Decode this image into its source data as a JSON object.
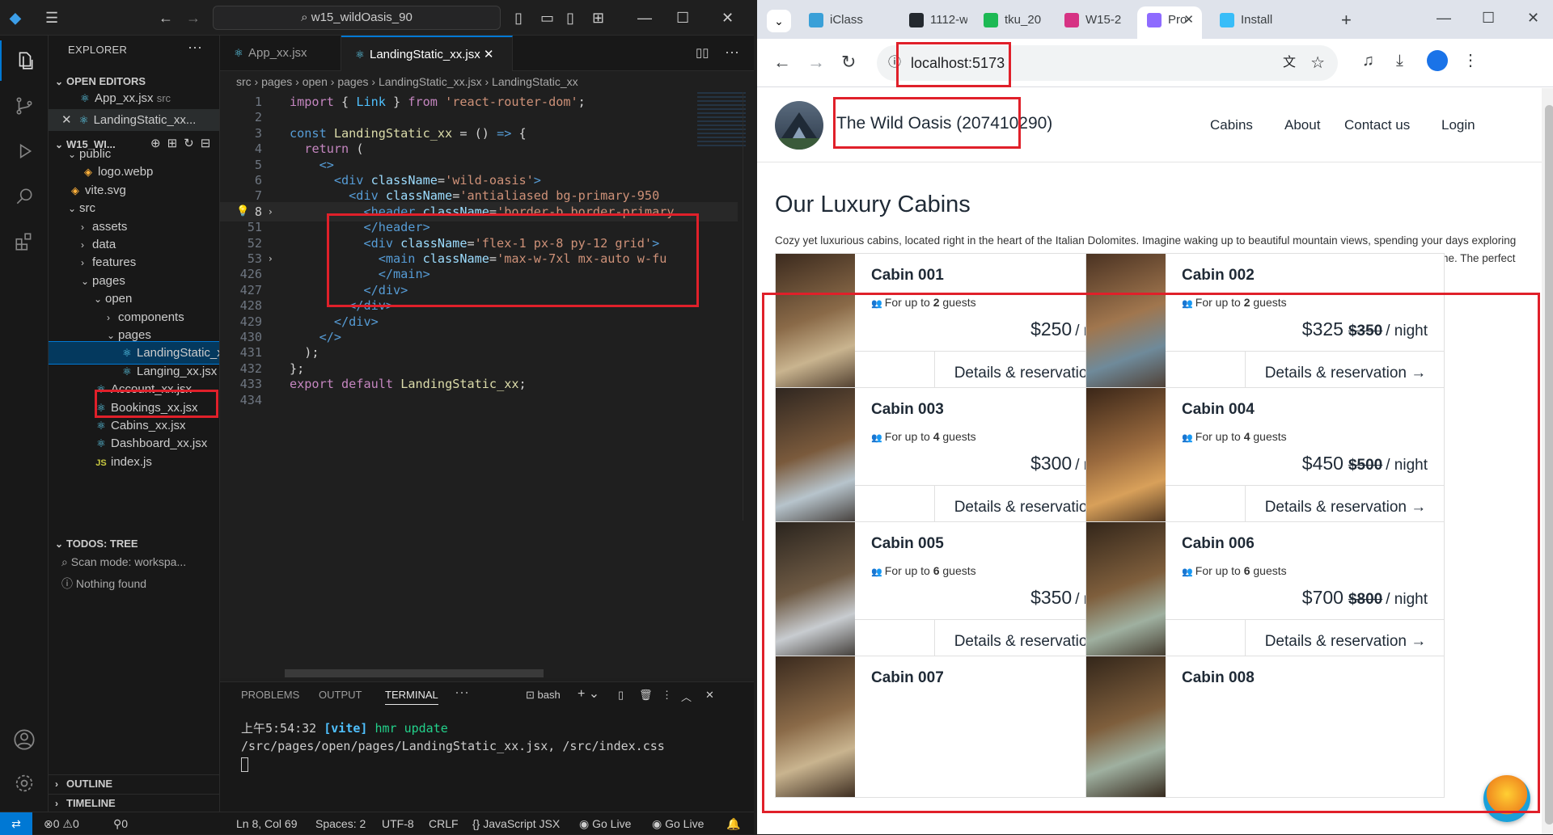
{
  "vscode": {
    "command_center": "w15_wildOasis_90",
    "explorer_title": "EXPLORER",
    "open_editors_title": "OPEN EDITORS",
    "open_editors": [
      {
        "name": "App_xx.jsx",
        "detail": "src"
      },
      {
        "name": "LandingStatic_xx..."
      }
    ],
    "workspace_title": "W15_WI...",
    "tree": [
      {
        "label": "public",
        "type": "folder"
      },
      {
        "label": "logo.webp",
        "type": "file"
      },
      {
        "label": "vite.svg",
        "type": "file"
      },
      {
        "label": "src",
        "type": "folder"
      },
      {
        "label": "assets",
        "type": "folder"
      },
      {
        "label": "data",
        "type": "folder"
      },
      {
        "label": "features",
        "type": "folder"
      },
      {
        "label": "pages",
        "type": "folder"
      },
      {
        "label": "open",
        "type": "folder"
      },
      {
        "label": "components",
        "type": "folder"
      },
      {
        "label": "pages",
        "type": "folder"
      },
      {
        "label": "LandingStatic_x...",
        "type": "file"
      },
      {
        "label": "Langing_xx.jsx",
        "type": "file"
      },
      {
        "label": "Account_xx.jsx",
        "type": "file"
      },
      {
        "label": "Bookings_xx.jsx",
        "type": "file"
      },
      {
        "label": "Cabins_xx.jsx",
        "type": "file"
      },
      {
        "label": "Dashboard_xx.jsx",
        "type": "file"
      },
      {
        "label": "index.js",
        "type": "file"
      }
    ],
    "todos_title": "TODOS: TREE",
    "todos_scan": "Scan mode: workspa...",
    "todos_nothing": "Nothing found",
    "outline_title": "OUTLINE",
    "timeline_title": "TIMELINE",
    "tabs": [
      "App_xx.jsx",
      "LandingStatic_xx.jsx"
    ],
    "breadcrumb": [
      "src",
      "pages",
      "open",
      "pages",
      "LandingStatic_xx.jsx",
      "LandingStatic_xx"
    ],
    "code_lines": [
      {
        "n": "1",
        "html": "<span class='kw'>import</span> { <span class='vr'>Link</span> } <span class='kw'>from</span> <span class='st'>'react-router-dom'</span>;"
      },
      {
        "n": "2",
        "html": ""
      },
      {
        "n": "3",
        "html": "<span class='bl'>const</span> <span class='fn'>LandingStatic_xx</span> = () <span class='bl'>=&gt;</span> {"
      },
      {
        "n": "4",
        "html": "  <span class='kw'>return</span> ("
      },
      {
        "n": "5",
        "html": "    <span class='tg'>&lt;&gt;</span>"
      },
      {
        "n": "6",
        "html": "      <span class='tg'>&lt;div</span> <span class='at'>className</span>=<span class='st'>'wild-oasis'</span><span class='tg'>&gt;</span>"
      },
      {
        "n": "7",
        "html": "        <span class='tg'>&lt;div</span> <span class='at'>className</span>=<span class='st'>'antialiased bg-primary-950</span>"
      },
      {
        "n": "8",
        "html": "          <span class='tg'>&lt;header</span> <span class='at'>className</span>=<span class='st'>'border-b border-primary</span>",
        "cur": true,
        "fold": true
      },
      {
        "n": "51",
        "html": "          <span class='tg'>&lt;/header&gt;</span>"
      },
      {
        "n": "52",
        "html": "          <span class='tg'>&lt;div</span> <span class='at'>className</span>=<span class='st'>'flex-1 px-8 py-12 grid'</span><span class='tg'>&gt;</span>"
      },
      {
        "n": "53",
        "html": "            <span class='tg'>&lt;main</span> <span class='at'>className</span>=<span class='st'>'max-w-7xl mx-auto w-fu</span>",
        "fold": true
      },
      {
        "n": "426",
        "html": "            <span class='tg'>&lt;/main&gt;</span>"
      },
      {
        "n": "427",
        "html": "          <span class='tg'>&lt;/div&gt;</span>"
      },
      {
        "n": "428",
        "html": "        <span class='tg'>&lt;/div&gt;</span>"
      },
      {
        "n": "429",
        "html": "      <span class='tg'>&lt;/div&gt;</span>"
      },
      {
        "n": "430",
        "html": "    <span class='tg'>&lt;/&gt;</span>"
      },
      {
        "n": "431",
        "html": "  );"
      },
      {
        "n": "432",
        "html": "};"
      },
      {
        "n": "433",
        "html": "<span class='kw'>export</span> <span class='kw'>default</span> <span class='fn'>LandingStatic_xx</span>;"
      },
      {
        "n": "434",
        "html": ""
      }
    ],
    "panel_tabs": [
      "PROBLEMS",
      "OUTPUT",
      "TERMINAL"
    ],
    "terminal_shell": "bash",
    "terminal_time": "上午5:54:32",
    "terminal_vite": "[vite]",
    "terminal_hmr": "hmr update",
    "terminal_path": "/src/pages/open/pages/LandingStatic_xx.jsx, /src/index.css",
    "status": {
      "errors": "0",
      "warnings": "0",
      "ports": "0",
      "position": "Ln 8, Col 69",
      "spaces": "Spaces: 2",
      "encoding": "UTF-8",
      "eol": "CRLF",
      "language": "JavaScript JSX",
      "golive1": "Go Live",
      "golive2": "Go Live"
    }
  },
  "browser": {
    "tabs": [
      {
        "label": "iClass",
        "color": "#3aa0d8"
      },
      {
        "label": "1112-w",
        "color": "#24292f"
      },
      {
        "label": "tku_20",
        "color": "#1db954"
      },
      {
        "label": "W15-2",
        "color": "#d63384"
      },
      {
        "label": "Pro",
        "color": "#8e6bff",
        "active": true
      },
      {
        "label": "Install",
        "color": "#38bdf8"
      }
    ],
    "url": "localhost:5173",
    "site": {
      "brand": "The Wild Oasis (207410290)",
      "nav": [
        "Cabins",
        "About",
        "Contact us",
        "Login"
      ],
      "title": "Our Luxury Cabins",
      "intro": "Cozy yet luxurious cabins, located right in the heart of the Italian Dolomites. Imagine waking up to beautiful mountain views, spending your days exploring the dark forests around, or just relaxing in your private hot tub under the stars. Enjoy nature's beauty in your own little home away from home. The perfect spot for a peaceful, calm vacation. Welcome to paradise.",
      "guests_prefix": "For up to",
      "guests_suffix": "guests",
      "per_night": "/ night",
      "details_label": "Details & reservation →",
      "cabins": [
        {
          "name": "Cabin 001",
          "guests": "2",
          "price": "$250",
          "old": ""
        },
        {
          "name": "Cabin 002",
          "guests": "2",
          "price": "$325",
          "old": "$350"
        },
        {
          "name": "Cabin 003",
          "guests": "4",
          "price": "$300",
          "old": ""
        },
        {
          "name": "Cabin 004",
          "guests": "4",
          "price": "$450",
          "old": "$500"
        },
        {
          "name": "Cabin 005",
          "guests": "6",
          "price": "$350",
          "old": ""
        },
        {
          "name": "Cabin 006",
          "guests": "6",
          "price": "$700",
          "old": "$800"
        },
        {
          "name": "Cabin 007",
          "guests": "",
          "price": "",
          "old": ""
        },
        {
          "name": "Cabin 008",
          "guests": "",
          "price": "",
          "old": ""
        }
      ]
    }
  }
}
